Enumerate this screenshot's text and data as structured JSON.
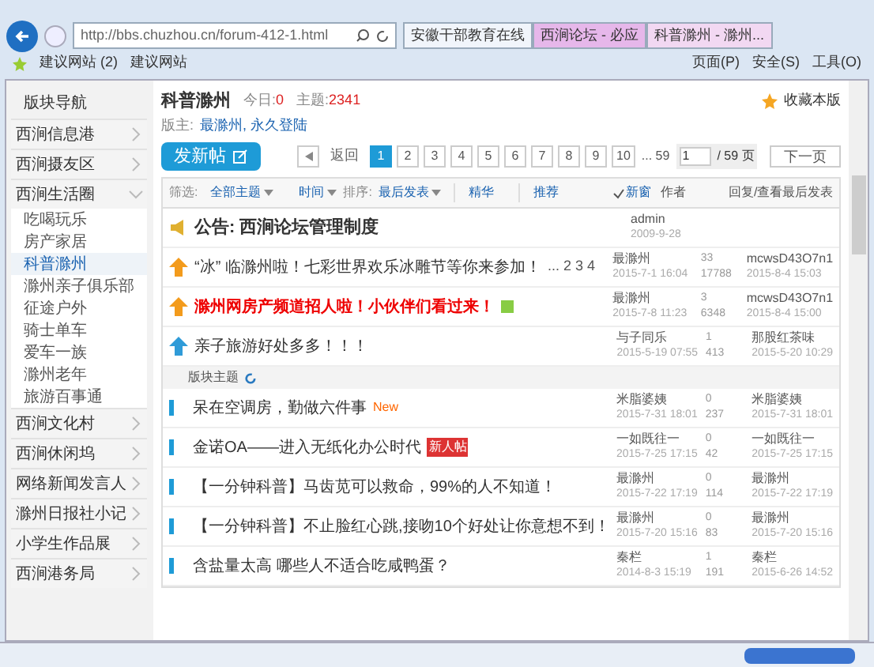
{
  "browser": {
    "url": "http://bbs.chuzhou.cn/forum-412-1.html",
    "tabs": [
      {
        "title": "安徽干部教育在线",
        "selected": false
      },
      {
        "title": "西涧论坛 - 必应",
        "selected": false
      },
      {
        "title": "科普滁州 - 滁州...",
        "selected": true
      }
    ],
    "favorites": [
      "建议网站 (2)",
      "建议网站"
    ],
    "menus": [
      "页面(P)",
      "安全(S)",
      "工具(O)"
    ]
  },
  "sidebar": {
    "title": "版块导航",
    "groups": [
      {
        "label": "西涧信息港",
        "expanded": false
      },
      {
        "label": "西涧摄友区",
        "expanded": false
      },
      {
        "label": "西涧生活圈",
        "expanded": true,
        "children": [
          {
            "label": "吃喝玩乐",
            "selected": false
          },
          {
            "label": "房产家居",
            "selected": false
          },
          {
            "label": "科普滁州",
            "selected": true
          },
          {
            "label": "滁州亲子俱乐部",
            "selected": false
          },
          {
            "label": "征途户外",
            "selected": false
          },
          {
            "label": "骑士单车",
            "selected": false
          },
          {
            "label": "爱车一族",
            "selected": false
          },
          {
            "label": "滁州老年",
            "selected": false
          },
          {
            "label": "旅游百事通",
            "selected": false
          }
        ]
      },
      {
        "label": "西涧文化村",
        "expanded": false
      },
      {
        "label": "西涧休闲坞",
        "expanded": false
      },
      {
        "label": "网络新闻发言人",
        "expanded": false
      },
      {
        "label": "滁州日报社小记",
        "expanded": false
      },
      {
        "label": "小学生作品展",
        "expanded": false
      },
      {
        "label": "西涧港务局",
        "expanded": false
      }
    ]
  },
  "forum": {
    "title": "科普滁州",
    "today_label": "今日:",
    "today": "0",
    "topics_label": "主题:",
    "topics": "2341",
    "favorite": "收藏本版",
    "moderators_label": "版主:",
    "moderators": "最滁州, 永久登陆"
  },
  "pager": {
    "new_post": "发新帖",
    "back": "返回",
    "pages": [
      {
        "label": "1",
        "selected": true
      },
      {
        "label": "2",
        "selected": false
      },
      {
        "label": "3",
        "selected": false
      },
      {
        "label": "4",
        "selected": false
      },
      {
        "label": "5",
        "selected": false
      },
      {
        "label": "6",
        "selected": false
      },
      {
        "label": "7",
        "selected": false
      },
      {
        "label": "8",
        "selected": false
      },
      {
        "label": "9",
        "selected": false
      },
      {
        "label": "10",
        "selected": false
      }
    ],
    "last": "... 59",
    "page_input": "1",
    "page_total": "/ 59 页",
    "next": "下一页"
  },
  "filter": {
    "label": "筛选:",
    "type": "全部主题",
    "time": "时间",
    "sort_label": "排序:",
    "sort": "最后发表",
    "digest": "精华",
    "recommend": "推荐",
    "new_window": {
      "label": "新窗",
      "checked": true
    },
    "columns": [
      "作者",
      "回复/查看",
      "最后发表"
    ]
  },
  "threads": [
    {
      "kind": "announce",
      "title": "公告: 西涧论坛管理制度",
      "highlight": false,
      "author": "admin",
      "date": "2009-9-28"
    },
    {
      "kind": "sticky",
      "title": "“冰” 临滁州啦！七彩世界欢乐冰雕节等你来参加！",
      "highlight": false,
      "pages": "... 2 3 4",
      "author": "最滁州",
      "date": "2015-7-1 16:04",
      "replies": "33",
      "views": "17788",
      "last_user": "mcwsD43O7n1",
      "last_date": "2015-8-4 15:03"
    },
    {
      "kind": "sticky",
      "title": "滁州网房产频道招人啦！小伙伴们看过来！",
      "highlight": true,
      "author": "最滁州",
      "date": "2015-7-8 11:23",
      "replies": "3",
      "views": "6348",
      "last_user": "mcwsD43O7n1",
      "last_date": "2015-8-4 15:00"
    },
    {
      "kind": "pinned",
      "title": "亲子旅游好处多多！！！",
      "highlight": false,
      "author": "与子同乐",
      "date": "2015-5-19 07:55",
      "replies": "1",
      "views": "413",
      "last_user": "那股红茶味",
      "last_date": "2015-5-20 10:29"
    }
  ],
  "section_label": "版块主题",
  "topics": [
    {
      "title": "呆在空调房，勤做六件事",
      "badge": {
        "text": "New",
        "kind": "new"
      },
      "author": "米脂婆姨",
      "date": "2015-7-31 18:01",
      "replies": "0",
      "views": "237",
      "last_user": "米脂婆姨",
      "last_date": "2015-7-31 18:01"
    },
    {
      "title": "金诺OA——进入无纸化办公时代",
      "badge": {
        "text": "新人帖",
        "kind": "newbie"
      },
      "author": "一如既往一",
      "date": "2015-7-25 17:15",
      "replies": "0",
      "views": "42",
      "last_user": "一如既往一",
      "last_date": "2015-7-25 17:15"
    },
    {
      "title": "【一分钟科普】马齿苋可以救命，99%的人不知道！",
      "author": "最滁州",
      "date": "2015-7-22 17:19",
      "replies": "0",
      "views": "114",
      "last_user": "最滁州",
      "last_date": "2015-7-22 17:19"
    },
    {
      "title": "【一分钟科普】不止脸红心跳,接吻10个好处让你意想不到！",
      "author": "最滁州",
      "date": "2015-7-20 15:16",
      "replies": "0",
      "views": "83",
      "last_user": "最滁州",
      "last_date": "2015-7-20 15:16"
    },
    {
      "title": "含盐量太高 哪些人不适合吃咸鸭蛋？",
      "author": "秦栏",
      "date": "2014-8-3 15:19",
      "replies": "1",
      "views": "191",
      "last_user": "秦栏",
      "last_date": "2015-6-26 14:52"
    }
  ]
}
